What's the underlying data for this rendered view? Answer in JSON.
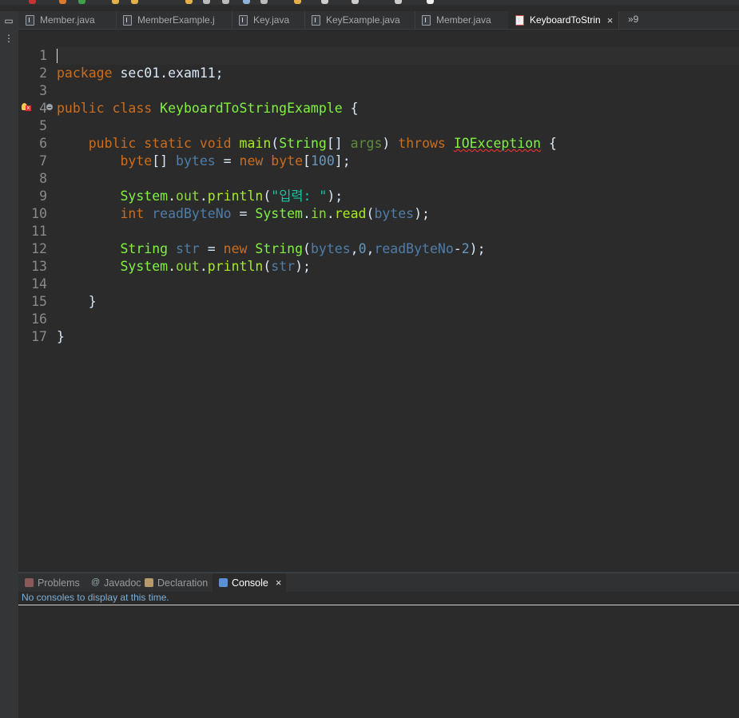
{
  "editor_tabs": [
    {
      "label": "Member.java",
      "active": false
    },
    {
      "label": "MemberExample.j",
      "active": false
    },
    {
      "label": "Key.java",
      "active": false
    },
    {
      "label": "KeyExample.java",
      "active": false
    },
    {
      "label": "Member.java",
      "active": false
    },
    {
      "label": "KeyboardToStrin",
      "active": true
    }
  ],
  "tab_overflow": "»9",
  "close_glyph": "×",
  "line_numbers": [
    "1",
    "2",
    "3",
    "4",
    "5",
    "6",
    "7",
    "8",
    "9",
    "10",
    "11",
    "12",
    "13",
    "14",
    "15",
    "16",
    "17"
  ],
  "code": {
    "l1": {
      "kw": "package",
      "rest": " sec01.exam11;"
    },
    "l3": {
      "kw1": "public",
      "kw2": "class",
      "name": "KeyboardToStringExample",
      "rest": " {"
    },
    "l5": {
      "kw1": "public",
      "kw2": "static",
      "kw3": "void",
      "method": "main",
      "p1": "(",
      "type": "String",
      "p2": "[] ",
      "param": "args",
      "p3": ") ",
      "throws": "throws",
      "exc": "IOException",
      "rest": " {"
    },
    "l6": {
      "type": "byte",
      "p1": "[] ",
      "var": "bytes",
      "eq": " = ",
      "kw": "new",
      "type2": "byte",
      "p2": "[",
      "num": "100",
      "p3": "];"
    },
    "l8": {
      "cls": "System",
      "dot1": ".",
      "field": "out",
      "dot2": ".",
      "method": "println",
      "p1": "(",
      "str": "\"입력: \"",
      "p2": ");"
    },
    "l9": {
      "type": "int",
      "var": "readByteNo",
      "eq": " = ",
      "cls": "System",
      "dot1": ".",
      "field": "in",
      "dot2": ".",
      "method": "read",
      "p1": "(",
      "arg": "bytes",
      "p2": ");"
    },
    "l11": {
      "type": "String",
      "var": "str",
      "eq": " = ",
      "kw": "new",
      "cls": "String",
      "p1": "(",
      "a1": "bytes",
      "c1": ",",
      "n1": "0",
      "c2": ",",
      "a2": "readByteNo",
      "minus": "-",
      "n2": "2",
      "p2": ");"
    },
    "l12": {
      "cls": "System",
      "dot1": ".",
      "field": "out",
      "dot2": ".",
      "method": "println",
      "p1": "(",
      "arg": "str",
      "p2": ");"
    },
    "l14": "}",
    "l16": "}"
  },
  "panel_tabs": [
    {
      "label": "Problems",
      "active": false
    },
    {
      "label": "Javadoc",
      "active": false
    },
    {
      "label": "Declaration",
      "active": false
    },
    {
      "label": "Console",
      "active": true
    }
  ],
  "console_message": "No consoles to display at this time.",
  "icons": {
    "sidebar": [
      "restore-icon",
      "menu-icon"
    ]
  }
}
